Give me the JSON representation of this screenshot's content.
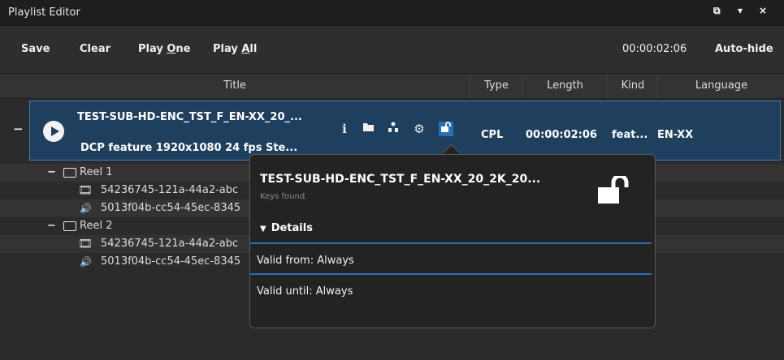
{
  "window": {
    "title": "Playlist Editor"
  },
  "toolbar": {
    "save": "Save",
    "clear": "Clear",
    "play_one_prefix": "Play ",
    "play_one_underline": "O",
    "play_one_suffix": "ne",
    "play_all_prefix": "Play ",
    "play_all_underline": "A",
    "play_all_suffix": "ll",
    "time": "00:00:02:06",
    "auto_hide": "Auto-hide"
  },
  "columns": [
    "Title",
    "Type",
    "Length",
    "Kind",
    "Language"
  ],
  "playlist": {
    "title": "TEST-SUB-HD-ENC_TST_F_EN-XX_20_...",
    "subtitle": "DCP  feature  1920x1080  24 fps  Ste...",
    "type": "CPL",
    "length": "00:00:02:06",
    "kind": "feat...",
    "language": "EN-XX",
    "icons": [
      "info-icon",
      "folder-open-icon",
      "sitemap-icon",
      "gear-icon",
      "unlock-icon"
    ]
  },
  "tree": {
    "reel1": "Reel 1",
    "reel1_picture": "54236745-121a-44a2-abc",
    "reel1_sound": "5013f04b-cc54-45ec-8345",
    "reel2": "Reel 2",
    "reel2_picture": "54236745-121a-44a2-abc",
    "reel2_sound": "5013f04b-cc54-45ec-8345"
  },
  "popover": {
    "title": "TEST-SUB-HD-ENC_TST_F_EN-XX_20_2K_20...",
    "keys_status": "Keys found.",
    "details_label": "Details",
    "valid_from_label": "Valid from:",
    "valid_from_value": "Always",
    "valid_until_label": "Valid until:",
    "valid_until_value": "Always"
  },
  "colors": {
    "accent": "#2a6fb5",
    "selected_row": "#1f3f5f",
    "background": "#2b2b2b"
  }
}
